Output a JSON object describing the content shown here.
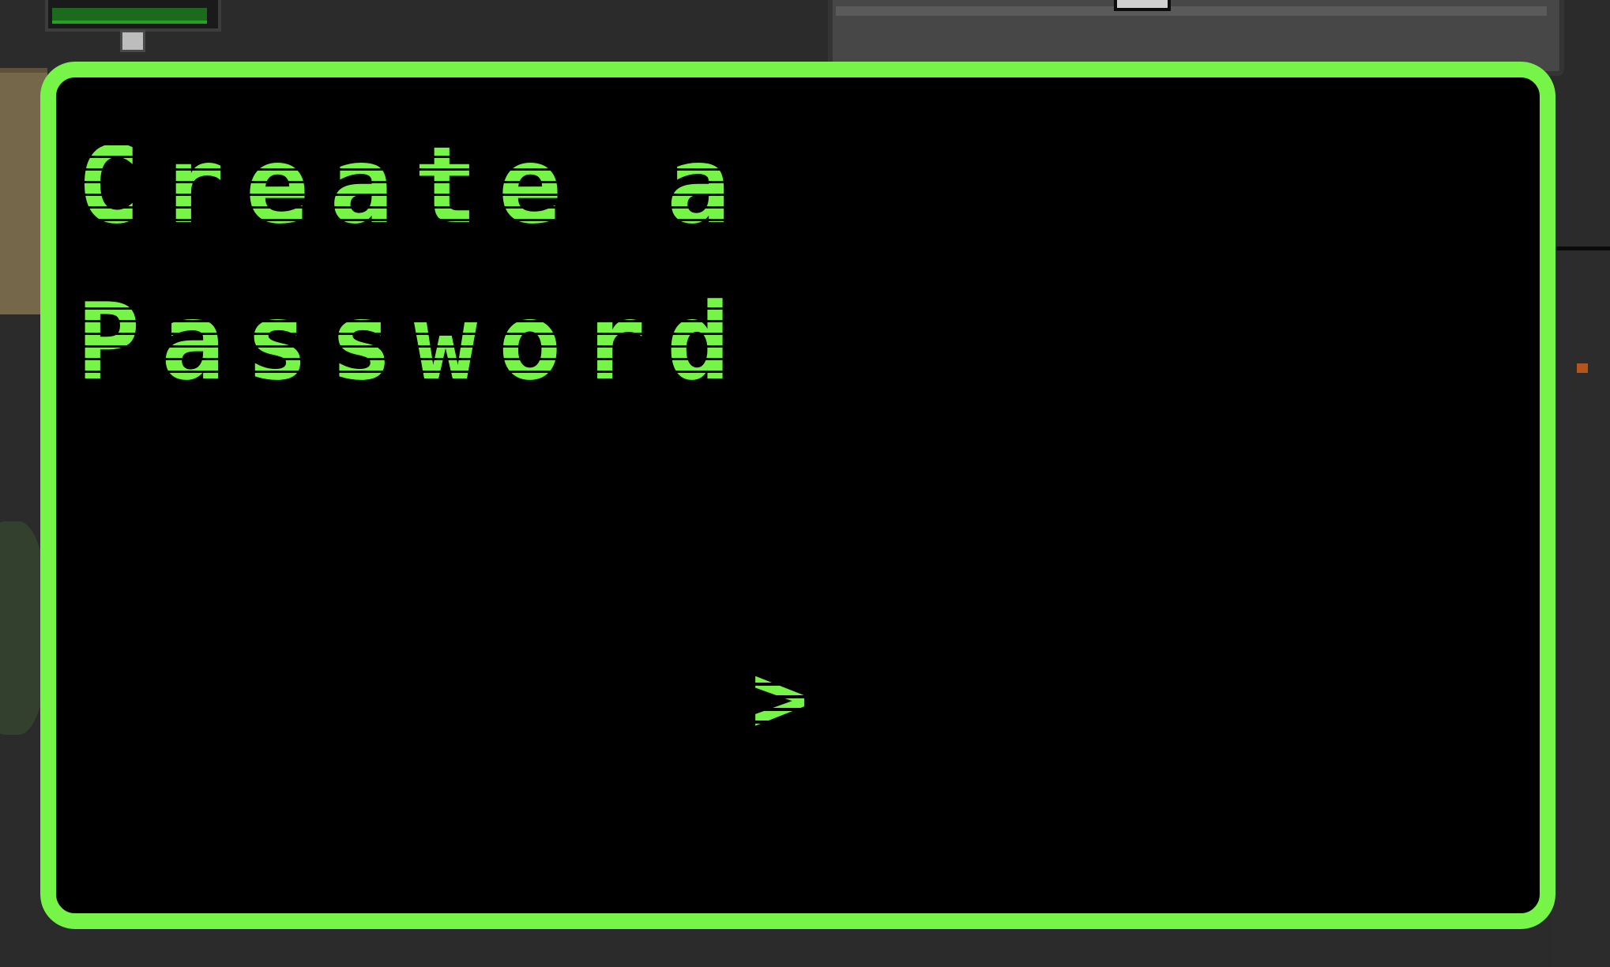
{
  "colors": {
    "terminal_accent": "#76f548",
    "terminal_background": "#000000",
    "scene_background": "#2a2a2a"
  },
  "terminal": {
    "title_lines": [
      "Create a",
      "Password"
    ],
    "prompt_symbol": ">",
    "password_value": ""
  }
}
